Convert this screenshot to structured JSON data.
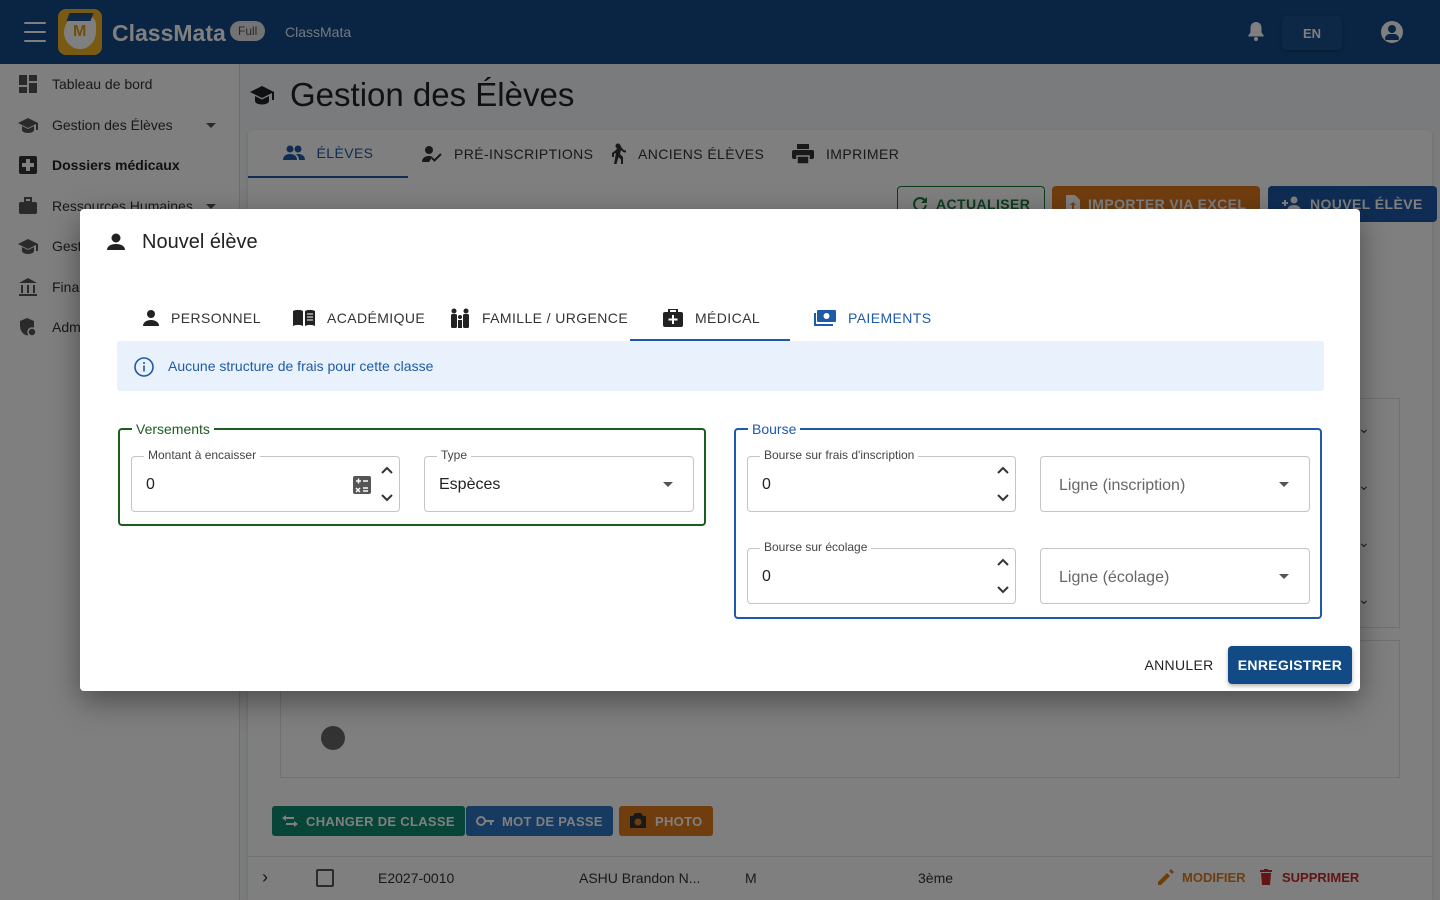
{
  "app": {
    "brand": "ClassMata",
    "edition_badge": "Full",
    "title": "ClassMata",
    "language": "EN"
  },
  "sidebar": {
    "items": [
      {
        "label": "Tableau de bord",
        "icon": "dashboard-icon"
      },
      {
        "label": "Gestion des Élèves",
        "icon": "school-icon"
      },
      {
        "label": "Dossiers médicaux",
        "icon": "medical-icon"
      },
      {
        "label": "Ressources Humaines",
        "icon": "briefcase-icon"
      },
      {
        "label": "Gest",
        "icon": "school-icon"
      },
      {
        "label": "Fina",
        "icon": "bank-icon"
      },
      {
        "label": "Adm",
        "icon": "admin-icon"
      }
    ]
  },
  "page": {
    "title": "Gestion des Élèves",
    "tabs": [
      {
        "label": "ÉLÈVES"
      },
      {
        "label": "PRÉ-INSCRIPTIONS"
      },
      {
        "label": "ANCIENS ÉLÈVES"
      },
      {
        "label": "IMPRIMER"
      }
    ],
    "actions": {
      "refresh": "ACTUALISER",
      "import": "IMPORTER VIA EXCEL",
      "new_student": "NOUVEL ÉLÈVE"
    },
    "row_actions": {
      "change_class": "CHANGER DE CLASSE",
      "password": "MOT DE PASSE",
      "photo": "PHOTO"
    },
    "table_row": {
      "id": "E2027-0010",
      "name": "ASHU Brandon N...",
      "gender": "M",
      "class": "3ème",
      "edit": "MODIFIER",
      "delete": "SUPPRIMER"
    }
  },
  "dialog": {
    "title": "Nouvel élève",
    "tabs": [
      {
        "label": "PERSONNEL"
      },
      {
        "label": "ACADÉMIQUE"
      },
      {
        "label": "FAMILLE / URGENCE"
      },
      {
        "label": "MÉDICAL"
      },
      {
        "label": "PAIEMENTS"
      }
    ],
    "info_message": "Aucune structure de frais pour cette classe",
    "versements": {
      "legend": "Versements",
      "amount_label": "Montant à encaisser",
      "amount_value": "0",
      "type_label": "Type",
      "type_value": "Espèces"
    },
    "bourse": {
      "legend": "Bourse",
      "inscription_label": "Bourse sur frais d'inscription",
      "inscription_value": "0",
      "inscription_line_placeholder": "Ligne (inscription)",
      "ecolage_label": "Bourse sur écolage",
      "ecolage_value": "0",
      "ecolage_line_placeholder": "Ligne (écolage)"
    },
    "cancel": "ANNULER",
    "save": "ENREGISTRER"
  },
  "colors": {
    "appbar": "#124a86",
    "primary": "#1e5aa8",
    "success": "#1b7a3a",
    "warning": "#e07b1f",
    "teal": "#0f8a73",
    "danger": "#c62828"
  }
}
